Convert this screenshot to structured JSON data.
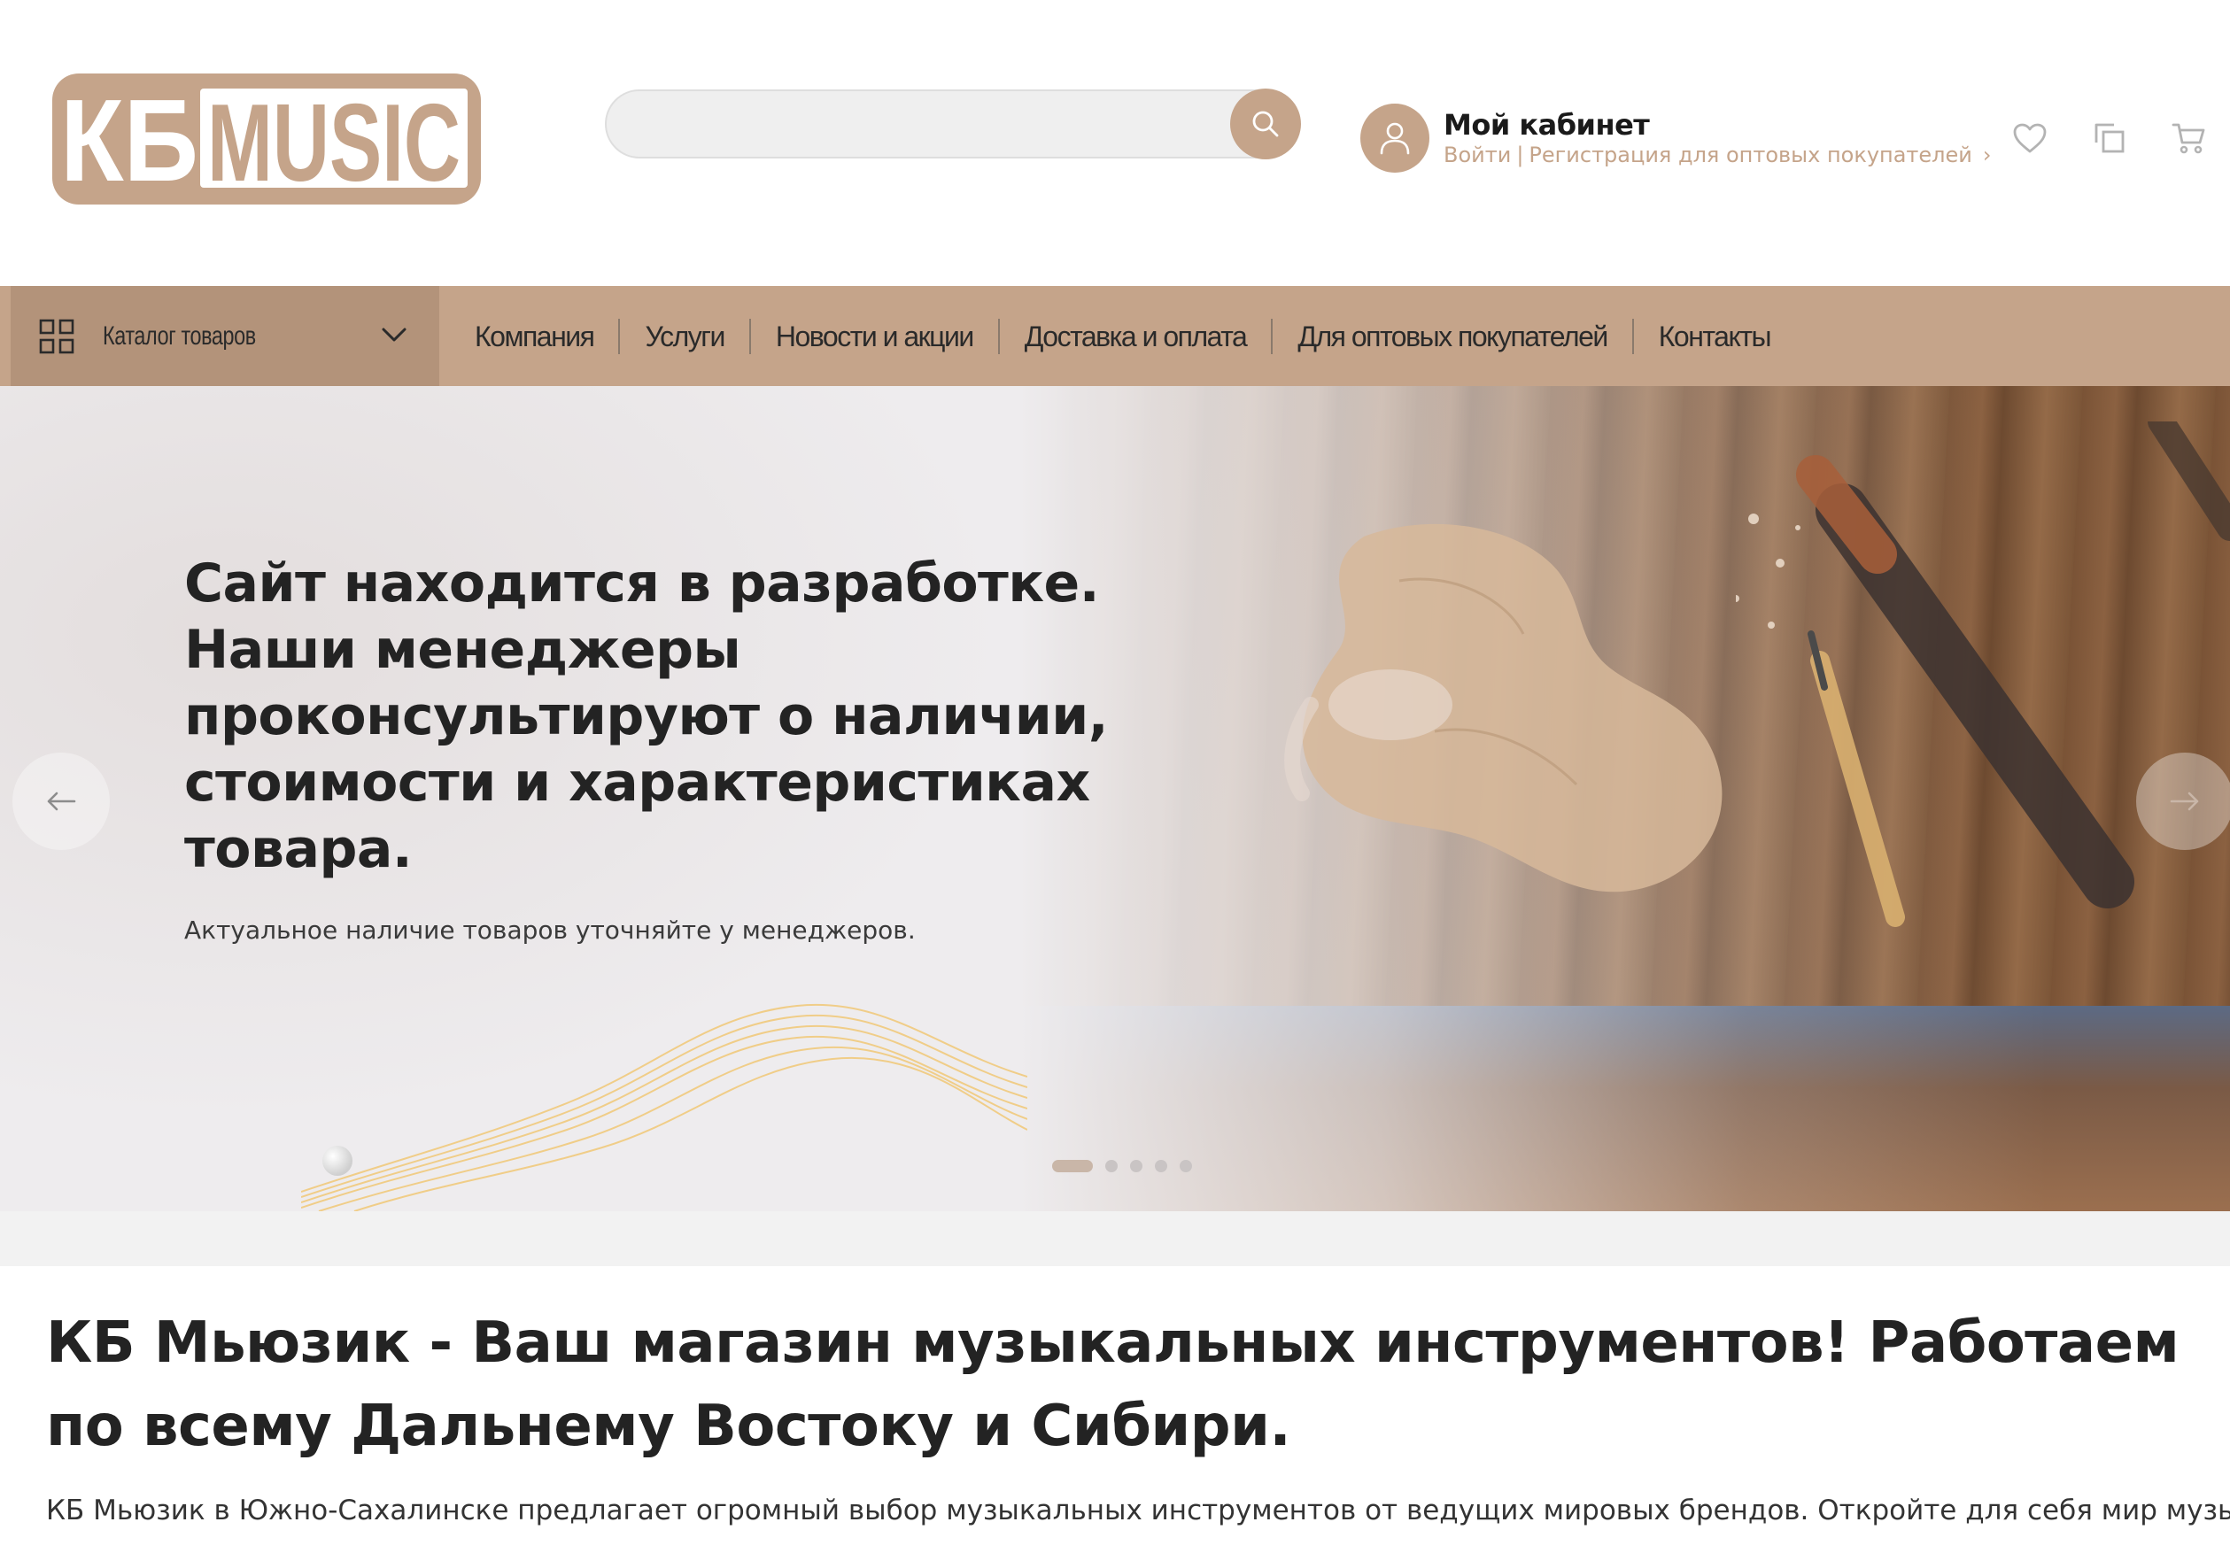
{
  "brand": {
    "logo_left": "КБ",
    "logo_right": "MUSIC",
    "accent": "#c5a48a",
    "accent_dark": "#b3937a"
  },
  "search": {
    "placeholder": "",
    "value": ""
  },
  "account": {
    "title": "Мой кабинет",
    "login": "Войти",
    "separator": "|",
    "register": "Регистрация для оптовых покупателей",
    "chevron": "›"
  },
  "header_icons": [
    "heart-icon",
    "compare-icon",
    "cart-icon"
  ],
  "nav": {
    "catalog_label": "Каталог товаров",
    "items": [
      {
        "label": "Компания"
      },
      {
        "label": "Услуги"
      },
      {
        "label": "Новости и акции"
      },
      {
        "label": "Доставка и оплата"
      },
      {
        "label": "Для оптовых покупателей"
      },
      {
        "label": "Контакты"
      }
    ]
  },
  "hero": {
    "title": "Сайт находится в разработке. Наши менеджеры проконсультируют о наличии, стоимости и характеристиках товара.",
    "subtitle": "Актуальное наличие товаров уточняйте у менеджеров.",
    "slides_total": 5,
    "active_slide": 1
  },
  "content": {
    "title": "КБ Мьюзик - Ваш магазин музыкальных инструментов! Работаем по всему Дальнему Востоку и Сибири.",
    "text": "КБ Мьюзик в Южно-Сахалинске предлагает огромный выбор музыкальных инструментов от ведущих мировых брендов. Откройте для себя мир музыки с"
  }
}
